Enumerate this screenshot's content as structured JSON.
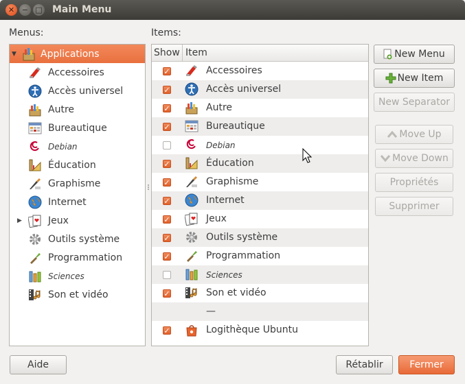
{
  "window": {
    "title": "Main Menu"
  },
  "labels": {
    "menus": "Menus:",
    "items": "Items:"
  },
  "menus_tree": [
    {
      "label": "Applications",
      "icon": "applications-icon",
      "selected": true,
      "expander": "▼",
      "italic": false
    },
    {
      "label": "Accessoires",
      "icon": "accessories-icon",
      "italic": false
    },
    {
      "label": "Accès universel",
      "icon": "universal-access-icon",
      "italic": false
    },
    {
      "label": "Autre",
      "icon": "other-icon",
      "italic": false
    },
    {
      "label": "Bureautique",
      "icon": "office-icon",
      "italic": false
    },
    {
      "label": "Debian",
      "icon": "debian-icon",
      "italic": true
    },
    {
      "label": "Éducation",
      "icon": "education-icon",
      "italic": false
    },
    {
      "label": "Graphisme",
      "icon": "graphics-icon",
      "italic": false
    },
    {
      "label": "Internet",
      "icon": "internet-icon",
      "italic": false
    },
    {
      "label": "Jeux",
      "icon": "games-icon",
      "expander": "▶",
      "italic": false
    },
    {
      "label": "Outils système",
      "icon": "system-tools-icon",
      "italic": false
    },
    {
      "label": "Programmation",
      "icon": "programming-icon",
      "italic": false
    },
    {
      "label": "Sciences",
      "icon": "science-icon",
      "italic": true
    },
    {
      "label": "Son et vidéo",
      "icon": "sound-video-icon",
      "italic": false
    }
  ],
  "items_list": {
    "columns": {
      "show": "Show",
      "item": "Item"
    },
    "rows": [
      {
        "show": true,
        "label": "Accessoires",
        "icon": "accessories-icon",
        "italic": false
      },
      {
        "show": true,
        "label": "Accès universel",
        "icon": "universal-access-icon",
        "italic": false
      },
      {
        "show": true,
        "label": "Autre",
        "icon": "other-icon",
        "italic": false
      },
      {
        "show": true,
        "label": "Bureautique",
        "icon": "office-icon",
        "italic": false
      },
      {
        "show": false,
        "label": "Debian",
        "icon": "debian-icon",
        "italic": true
      },
      {
        "show": true,
        "label": "Éducation",
        "icon": "education-icon",
        "italic": false
      },
      {
        "show": true,
        "label": "Graphisme",
        "icon": "graphics-icon",
        "italic": false
      },
      {
        "show": true,
        "label": "Internet",
        "icon": "internet-icon",
        "italic": false
      },
      {
        "show": true,
        "label": "Jeux",
        "icon": "games-icon",
        "italic": false
      },
      {
        "show": true,
        "label": "Outils système",
        "icon": "system-tools-icon",
        "italic": false
      },
      {
        "show": true,
        "label": "Programmation",
        "icon": "programming-icon",
        "italic": false
      },
      {
        "show": false,
        "label": "Sciences",
        "icon": "science-icon",
        "italic": true
      },
      {
        "show": true,
        "label": "Son et vidéo",
        "icon": "sound-video-icon",
        "italic": false
      },
      {
        "separator": true,
        "label": "—"
      },
      {
        "show": true,
        "label": "Logithèque Ubuntu",
        "icon": "software-center-icon",
        "italic": false
      }
    ]
  },
  "buttons": {
    "new_menu": "New Menu",
    "new_item": "New Item",
    "new_separator": "New Separator",
    "move_up": "Move Up",
    "move_down": "Move Down",
    "properties": "Propriétés",
    "delete": "Supprimer",
    "help": "Aide",
    "revert": "Rétablir",
    "close": "Fermer"
  },
  "colors": {
    "accent": "#e9703e",
    "titlebar": "#3c3b37",
    "window_bg": "#f2f1f0"
  }
}
